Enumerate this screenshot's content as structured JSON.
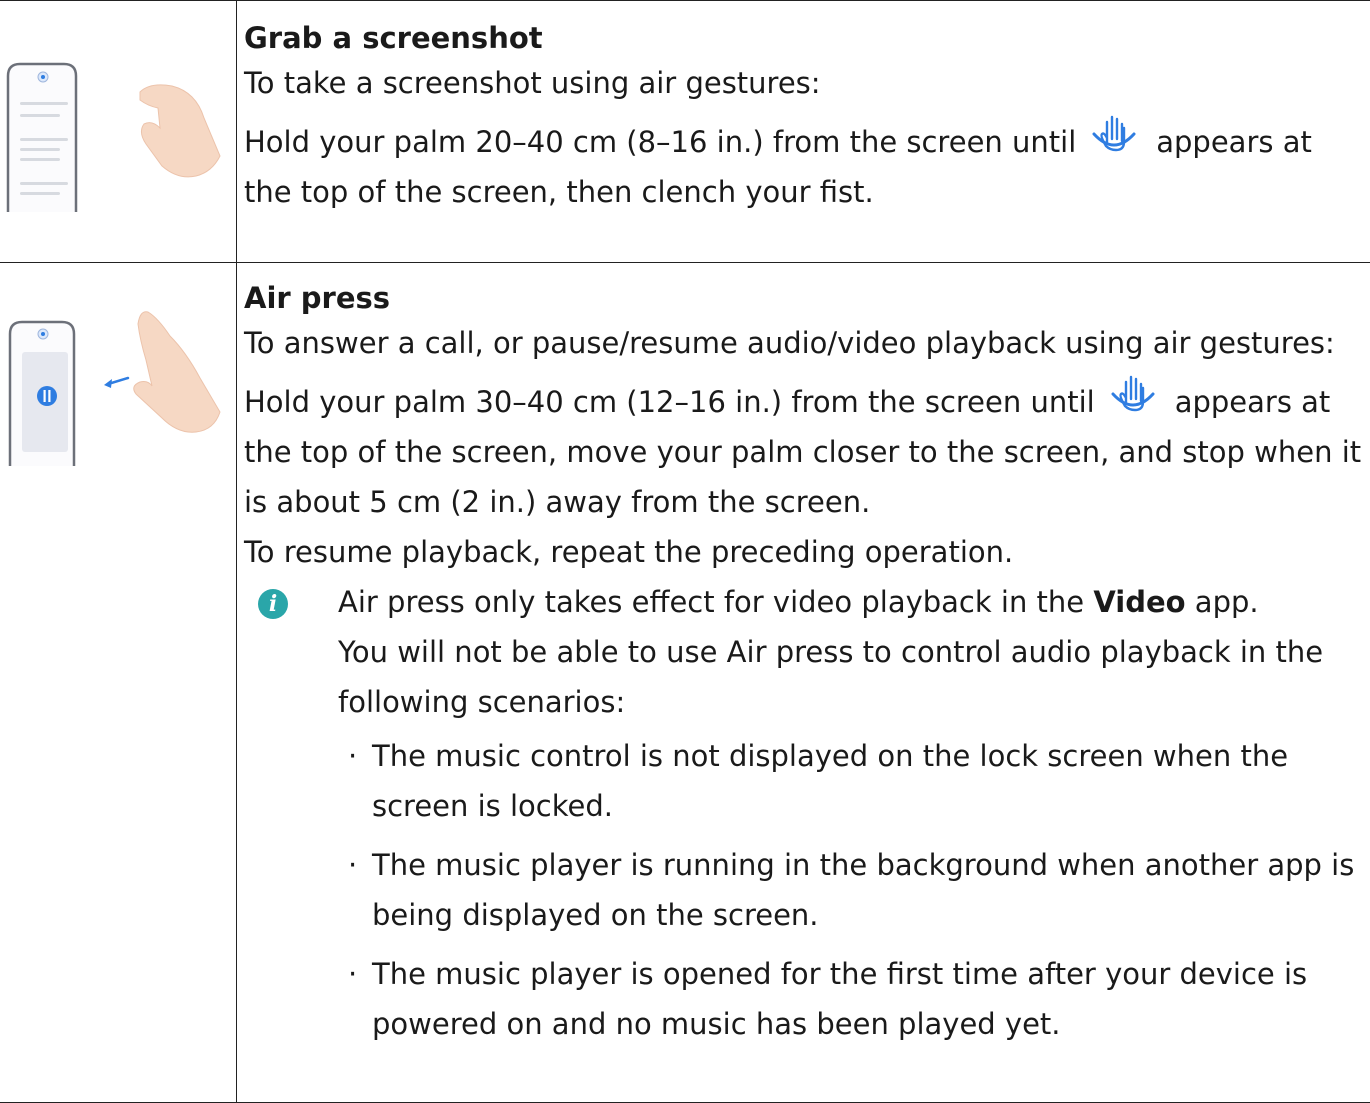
{
  "rows": [
    {
      "title": "Grab a screenshot",
      "intro": "To take a screenshot using air gestures:",
      "instruction_before": "Hold your palm 20–40 cm (8–16 in.) from the screen until",
      "instruction_after": "appears at the top of the screen, then clench your fist."
    },
    {
      "title": "Air press",
      "intro": "To answer a call, or pause/resume audio/video playback using air gestures:",
      "instruction_before": "Hold your palm 30–40 cm (12–16 in.) from the screen until",
      "instruction_after": "appears at the top of the screen, move your palm closer to the screen, and stop when it is about 5 cm (2 in.) away from the screen.",
      "resume": "To resume playback, repeat the preceding operation.",
      "note": {
        "icon": "info-icon",
        "icon_color": "#2aa6a9",
        "line1_before": "Air press only takes effect for video playback in the ",
        "line1_bold": "Video",
        "line1_after": " app.",
        "line2": "You will not be able to use Air press to control audio playback in the following scenarios:",
        "bullets": [
          "The music control is not displayed on the lock screen when the screen is locked.",
          "The music player is running in the background when another app is being displayed on the screen.",
          "The music player is opened for the first time after your device is powered on and no music has been played yet."
        ]
      }
    }
  ],
  "icons": {
    "inline_hand": "hand-gesture-icon",
    "accent": "#2f7de1",
    "skin": "#f6d8c4"
  }
}
